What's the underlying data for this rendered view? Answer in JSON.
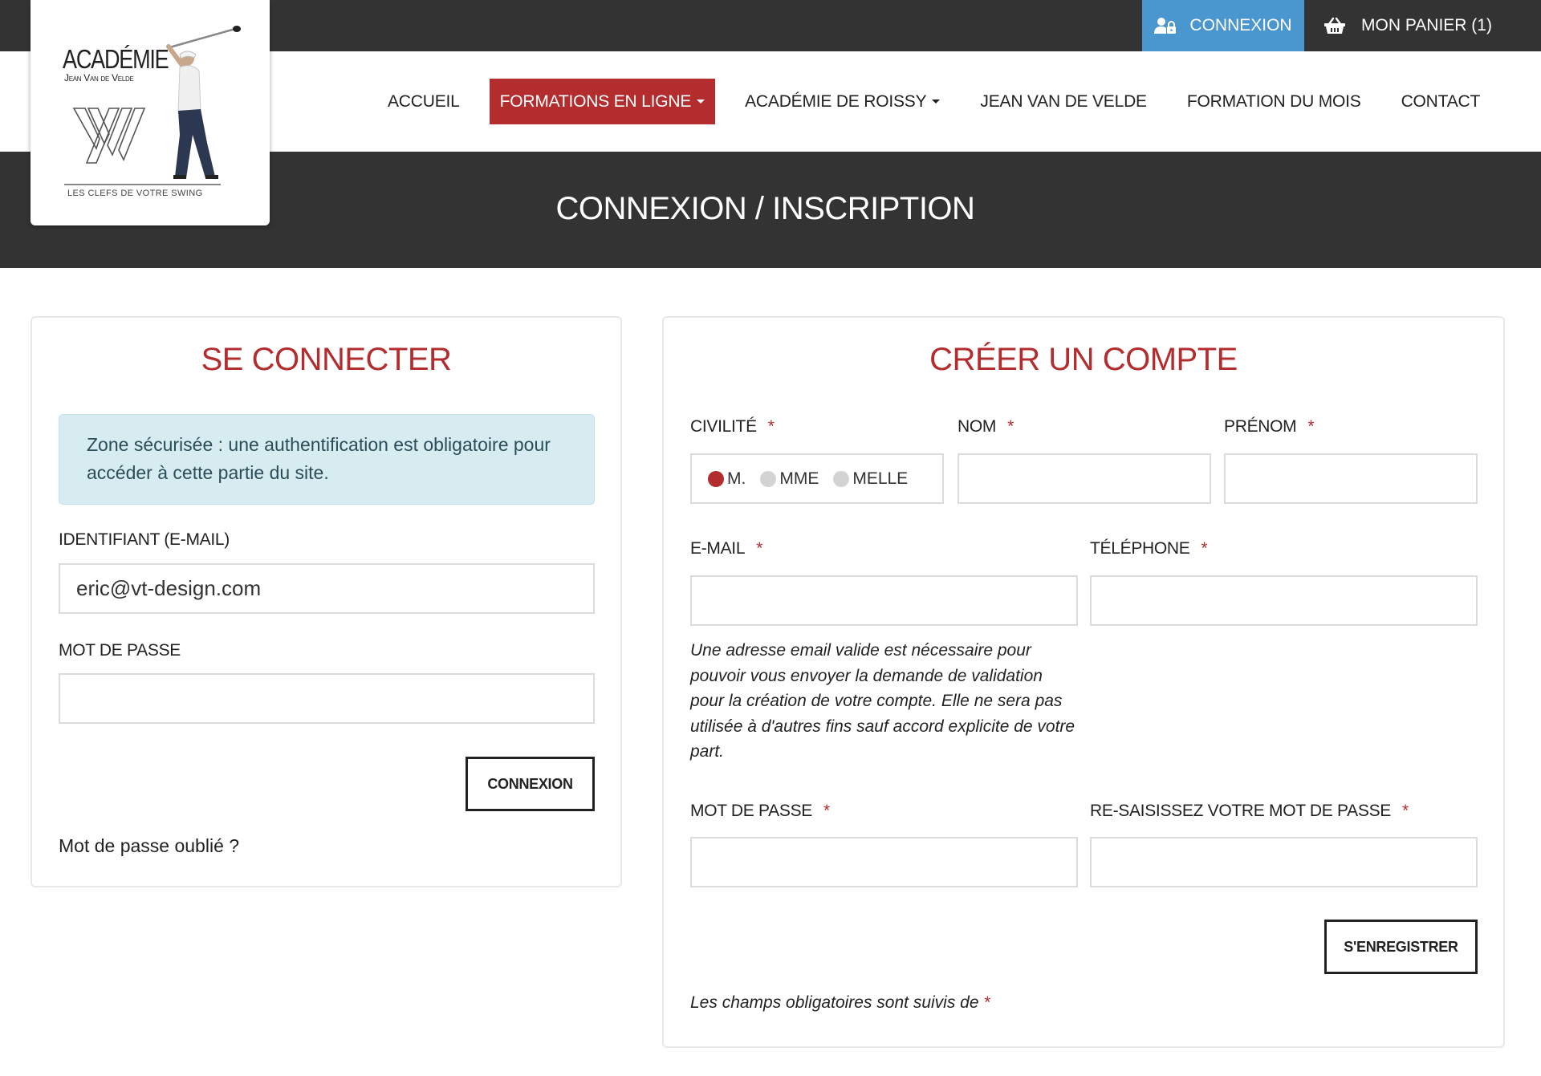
{
  "topbar": {
    "login_label": "CONNEXION",
    "login_icon": "user-lock-icon",
    "cart_label": "MON PANIER (1)",
    "cart_icon": "basket-icon"
  },
  "logo": {
    "title": "ACADÉMIE",
    "subtitle": "Jean Van de Velde",
    "tagline": "LES CLEFS DE VOTRE SWING"
  },
  "nav": {
    "items": [
      {
        "label": "ACCUEIL",
        "active": false,
        "dropdown": false
      },
      {
        "label": "FORMATIONS EN LIGNE",
        "active": true,
        "dropdown": true
      },
      {
        "label": "ACADÉMIE DE ROISSY",
        "active": false,
        "dropdown": true
      },
      {
        "label": "JEAN VAN DE VELDE",
        "active": false,
        "dropdown": false
      },
      {
        "label": "FORMATION DU MOIS",
        "active": false,
        "dropdown": false
      },
      {
        "label": "CONTACT",
        "active": false,
        "dropdown": false
      }
    ]
  },
  "hero": {
    "title": "CONNEXION / INSCRIPTION"
  },
  "login": {
    "title": "SE CONNECTER",
    "alert": "Zone sécurisée : une authentification est obligatoire pour accéder à cette partie du site.",
    "email_label": "IDENTIFIANT (E-MAIL)",
    "email_value": "eric@vt-design.com",
    "password_label": "MOT DE PASSE",
    "password_value": "",
    "submit_label": "CONNEXION",
    "forgot_label": "Mot de passe oublié ?"
  },
  "register": {
    "title": "CRÉER UN COMPTE",
    "required_mark": "*",
    "civility_label": "CIVILITÉ",
    "civility_options": [
      {
        "label": "M.",
        "checked": true
      },
      {
        "label": "MME",
        "checked": false
      },
      {
        "label": "MELLE",
        "checked": false
      }
    ],
    "lastname_label": "NOM",
    "firstname_label": "PRÉNOM",
    "email_label": "E-MAIL",
    "phone_label": "TÉLÉPHONE",
    "email_help": "Une adresse email valide est nécessaire pour pouvoir vous envoyer la demande de validation pour la création de votre compte. Elle ne sera pas utilisée à d'autres fins sauf accord explicite de votre part.",
    "password_label": "MOT DE PASSE",
    "password_confirm_label": "RE-SAISISSEZ VOTRE MOT DE PASSE",
    "submit_label": "S'ENREGISTRER",
    "required_note": "Les champs obligatoires sont suivis de"
  },
  "colors": {
    "brand_red": "#b32d2e",
    "top_blue": "#4a96cf",
    "dark_bar": "#333333",
    "alert_bg": "#d7ecf1"
  }
}
